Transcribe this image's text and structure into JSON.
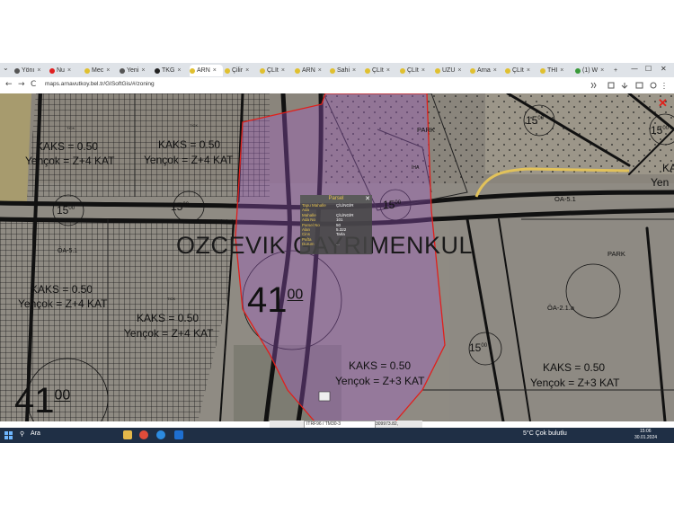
{
  "browser": {
    "tabs": [
      {
        "label": "Yönı"
      },
      {
        "label": "Nu"
      },
      {
        "label": "Mec"
      },
      {
        "label": "Yeni"
      },
      {
        "label": "TKG"
      },
      {
        "label": "ARN",
        "active": true
      },
      {
        "label": "Çilir"
      },
      {
        "label": "ÇLIt"
      },
      {
        "label": "ARN"
      },
      {
        "label": "Sahi"
      },
      {
        "label": "ÇLIt"
      },
      {
        "label": "ÇLIt"
      },
      {
        "label": "UZU"
      },
      {
        "label": "Arna"
      },
      {
        "label": "ÇLIt"
      },
      {
        "label": "THI"
      },
      {
        "label": "(1) W"
      }
    ],
    "new_tab_label": "+",
    "url": "maps.arnavutkoy.bel.tr/GISoftGis/#/zoning",
    "back_icon": "←",
    "forward_icon": "→",
    "reload_icon": "C",
    "minimize": "—",
    "maximize": "☐",
    "close": "✕"
  },
  "map": {
    "close_icon": "✕",
    "labels": {
      "kaks1": "KAKS = 0.50",
      "yencok1": "Yençok = Z+4 KAT",
      "kaks2": "KAKS = 0.50",
      "yencok2": "Yençok = Z+4 KAT",
      "kaks3": "KAKS = 0.50",
      "yencok3": "Yençok = Z+4 KAT",
      "kaks4": "KAKS = 0.50",
      "yencok4": "Yençok = Z+4 KAT",
      "kaks5": "KAKS = 0.50",
      "yencok5": "Yençok = Z+3 KAT",
      "kaks6": "KAKS = 0.50",
      "yencok6": "Yençok = Z+3 KAT",
      "kaks7": "KA",
      "yencok7": "Yen",
      "fifteen": "15",
      "superscript00": "00",
      "big41": "41",
      "park1": "PARK",
      "park2": "PARK",
      "oa51a": "ÖA-5.1",
      "oa51b": "ÖA-5.1",
      "oa21a": "ÖA-2.1.a",
      "tick1": "TİCK",
      "tick2": "TİCK",
      "tick3": "TİCK",
      "iha": "İHA",
      "watermark": "OZCEVIK GAYRIMENKUL"
    }
  },
  "popup": {
    "title": "Parsel",
    "close": "✕",
    "rows": [
      {
        "label": "Tapu Mahalle",
        "value": "ÇİLİNGİR"
      },
      {
        "label": "Ada",
        "value": ""
      },
      {
        "label": "Mahalle",
        "value": "ÇİLİNGİR"
      },
      {
        "label": "Ada No",
        "value": "101"
      },
      {
        "label": "Parsel No",
        "value": "50"
      },
      {
        "label": "Alan",
        "value": "5.322"
      },
      {
        "label": "Cins",
        "value": "Tarla"
      },
      {
        "label": "Pafta",
        "value": ""
      },
      {
        "label": "Durum",
        "value": "..."
      }
    ]
  },
  "map_status": {
    "projection": "ITRF96 / TM30-3",
    "coordinates": "309973.82, 4565688.33"
  },
  "taskbar": {
    "search_placeholder": "Ara",
    "weather": "5°C  Çok bulutlu",
    "time": "15:06",
    "date": "30.01.2024"
  }
}
